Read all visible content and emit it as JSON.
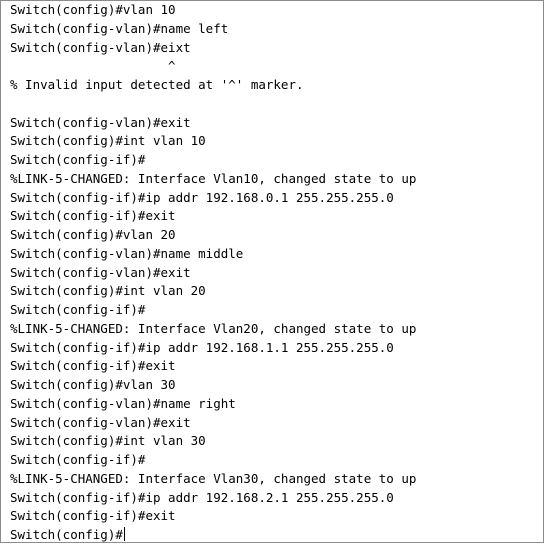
{
  "terminal": {
    "lines": [
      "Switch(config)#vlan 10",
      "Switch(config-vlan)#name left",
      "Switch(config-vlan)#eixt",
      "                     ^",
      "% Invalid input detected at '^' marker.",
      "",
      "Switch(config-vlan)#exit",
      "Switch(config)#int vlan 10",
      "Switch(config-if)#",
      "%LINK-5-CHANGED: Interface Vlan10, changed state to up",
      "Switch(config-if)#ip addr 192.168.0.1 255.255.255.0",
      "Switch(config-if)#exit",
      "Switch(config)#vlan 20",
      "Switch(config-vlan)#name middle",
      "Switch(config-vlan)#exit",
      "Switch(config)#int vlan 20",
      "Switch(config-if)#",
      "%LINK-5-CHANGED: Interface Vlan20, changed state to up",
      "Switch(config-if)#ip addr 192.168.1.1 255.255.255.0",
      "Switch(config-if)#exit",
      "Switch(config)#vlan 30",
      "Switch(config-vlan)#name right",
      "Switch(config-vlan)#exit",
      "Switch(config)#int vlan 30",
      "Switch(config-if)#",
      "%LINK-5-CHANGED: Interface Vlan30, changed state to up",
      "Switch(config-if)#ip addr 192.168.2.1 255.255.255.0",
      "Switch(config-if)#exit"
    ],
    "prompt": "Switch(config)#"
  }
}
